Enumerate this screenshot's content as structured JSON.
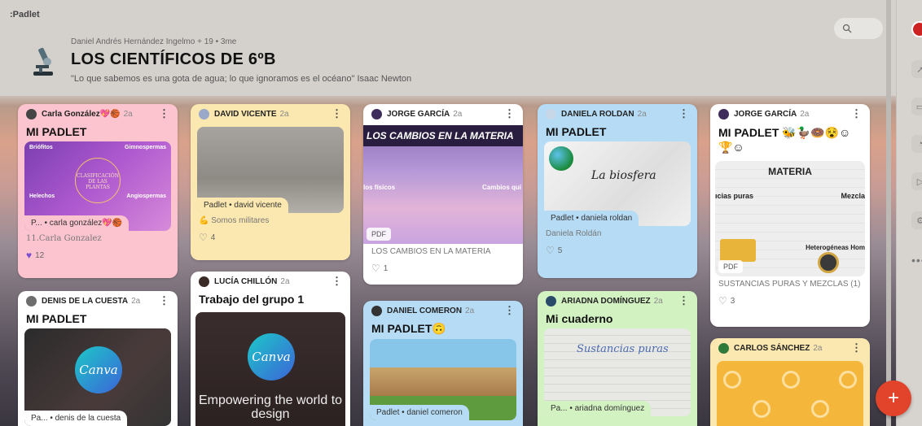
{
  "app": {
    "logo": ":Padlet"
  },
  "header": {
    "meta": "Daniel Andrés Hernández Ingelmo + 19 • 3me",
    "title": "LOS CIENTÍFICOS DE 6ºB",
    "subtitle": "\"Lo que sabemos es una gota de agua; lo que ignoramos es el océano\" Isaac Newton",
    "search_icon": "search-icon"
  },
  "cards": [
    {
      "author": "Carla González💖🏀",
      "ago": "2a",
      "title": "MI PADLET",
      "chip": "P... • carla gonzález💖🏀",
      "caption": "11.Carla Gonzalez",
      "likes": "12",
      "image_texts": [
        "Briófitos",
        "Gimnospermas",
        "Helechos",
        "Angiospermas",
        "CLASIFICACIÓN DE LAS PLANTAS"
      ]
    },
    {
      "author": "DAVID VICENTE",
      "ago": "2a",
      "chip": "Padlet • david vicente",
      "tag": "Somos militares",
      "likes": "4"
    },
    {
      "author": "JORGE GARCÍA",
      "ago": "2a",
      "image_title": "LOS CAMBIOS EN LA MATERIA",
      "image_left": "los físicos",
      "image_right": "Cambios quí",
      "badge": "PDF",
      "caption": "LOS CAMBIOS EN LA MATERIA",
      "likes": "1"
    },
    {
      "author": "DANIELA ROLDAN",
      "ago": "2a",
      "title": "MI PADLET",
      "image_text": "La biosfera",
      "chip": "Padlet • daniela roldan",
      "caption": "Daniela Roldán",
      "likes": "5"
    },
    {
      "author": "JORGE GARCÍA",
      "ago": "2a",
      "title": "MI PADLET 🐝🦆🍩😵☺",
      "title2": "🏆☺",
      "image_title": "MATERIA",
      "image_left": "ıcias puras",
      "image_right": "Mezcla",
      "badge": "PDF",
      "caption": "SUSTANCIAS PURAS Y MEZCLAS (1)",
      "likes": "3",
      "image_small": "Heterogéneas  Hom"
    },
    {
      "author": "DENIS DE LA CUESTA",
      "ago": "2a",
      "title": "MI PADLET",
      "image_text": "Canva",
      "chip": "Pa... • denis de la cuesta"
    },
    {
      "author": "LUCÍA CHILLÓN",
      "ago": "2a",
      "title": "Trabajo del grupo 1",
      "image_text": "Canva",
      "image_sub": "Empowering the world to design"
    },
    {
      "author": "DANIEL COMERON",
      "ago": "2a",
      "title": "MI PADLET🙃",
      "chip": "Padlet • daniel comeron"
    },
    {
      "author": "ARIADNA DOMÍNGUEZ",
      "ago": "2a",
      "title": "Mi cuaderno",
      "image_text": "Sustancias puras",
      "chip": "Pa... • ariadna domínguez"
    },
    {
      "author": "CARLOS SÁNCHEZ",
      "ago": "2a"
    }
  ],
  "colors": {
    "pink": "#fcc4cf",
    "yellow": "#fbe8b0",
    "blue": "#b6dcf5",
    "green": "#d3f2c2",
    "white": "#ffffff",
    "fab": "#e1442a"
  }
}
